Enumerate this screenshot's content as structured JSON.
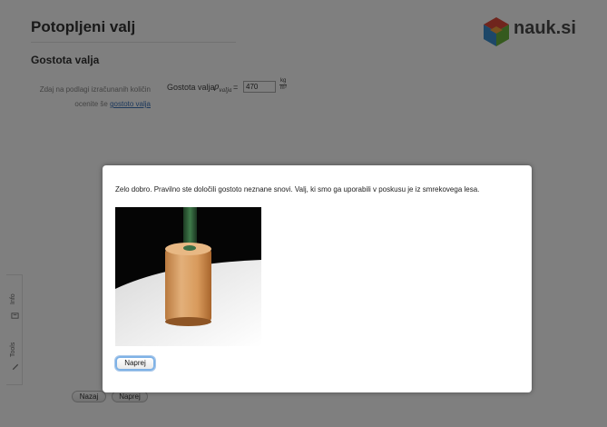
{
  "page": {
    "title": "Potopljeni valj",
    "section_title": "Gostota valja",
    "description_line1": "Zdaj na podlagi izračunanih količin",
    "description_line2_prefix": "ocenite še ",
    "description_link": "gostoto valja",
    "density_label": "Gostota valja:",
    "rho_symbol": "ρ",
    "rho_subscript": "valja",
    "equals": "=",
    "density_value": "470",
    "unit_numerator": "kg",
    "unit_denominator": "m³"
  },
  "logo": {
    "text": "nauk.si",
    "colors": [
      "#e04a3a",
      "#3a8ed0",
      "#6bb53c",
      "#f2a33a"
    ]
  },
  "side_tabs": {
    "info_label": "Info",
    "tools_label": "Tools"
  },
  "nav": {
    "back_label": "Nazaj",
    "next_label": "Naprej"
  },
  "dialog": {
    "message": "Zelo dobro. Pravilno ste določili gostoto neznane snovi. Valj, ki smo ga uporabili v poskusu je iz smrekovega lesa.",
    "button_label": "Naprej"
  }
}
